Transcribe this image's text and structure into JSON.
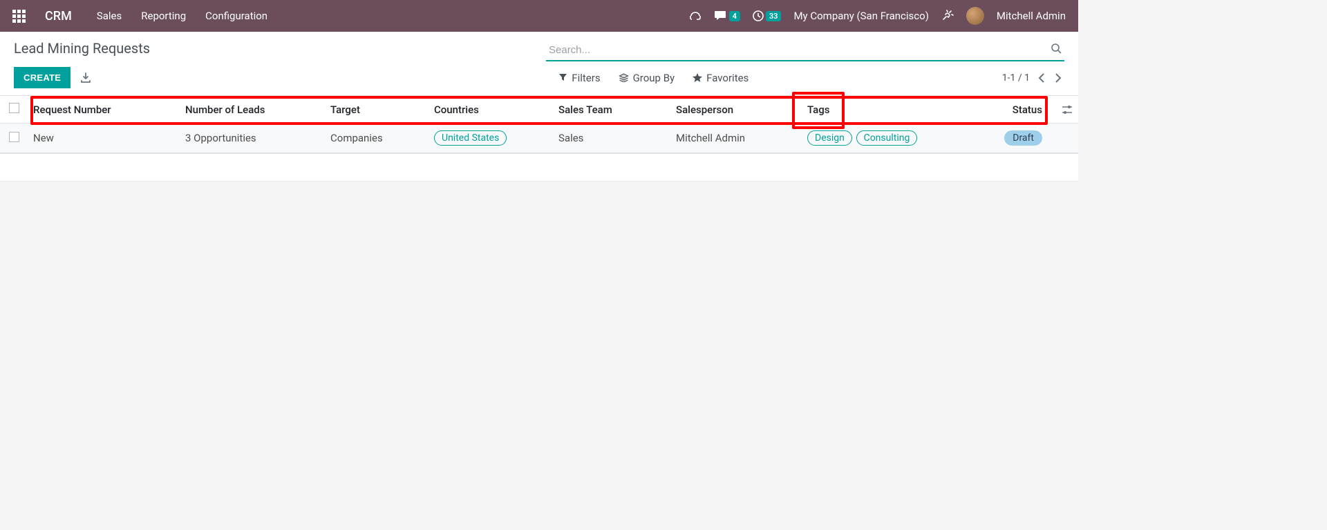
{
  "navbar": {
    "brand": "CRM",
    "menu": [
      "Sales",
      "Reporting",
      "Configuration"
    ],
    "messages_badge": "4",
    "activities_badge": "33",
    "company": "My Company (San Francisco)",
    "user": "Mitchell Admin"
  },
  "control": {
    "title": "Lead Mining Requests",
    "create_label": "CREATE",
    "search_placeholder": "Search...",
    "filters_label": "Filters",
    "groupby_label": "Group By",
    "favorites_label": "Favorites",
    "pager": "1-1 / 1"
  },
  "table": {
    "headers": {
      "request_number": "Request Number",
      "num_leads": "Number of Leads",
      "target": "Target",
      "countries": "Countries",
      "sales_team": "Sales Team",
      "salesperson": "Salesperson",
      "tags": "Tags",
      "status": "Status"
    },
    "rows": [
      {
        "request_number": "New",
        "num_leads": "3 Opportunities",
        "target": "Companies",
        "countries": [
          "United States"
        ],
        "sales_team": "Sales",
        "salesperson": "Mitchell Admin",
        "tags": [
          "Design",
          "Consulting"
        ],
        "status": "Draft"
      }
    ]
  }
}
